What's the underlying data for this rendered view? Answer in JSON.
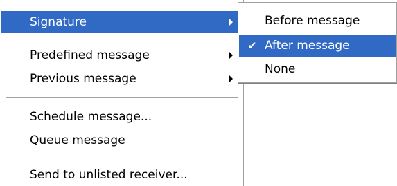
{
  "main_menu": {
    "items": [
      {
        "label": "Signature",
        "has_submenu": true,
        "highlighted": true
      },
      {
        "label": "Predefined message",
        "has_submenu": true
      },
      {
        "label": "Previous message",
        "has_submenu": true
      },
      {
        "label": "Schedule message..."
      },
      {
        "label": "Queue message"
      },
      {
        "label": "Send to unlisted receiver..."
      }
    ]
  },
  "signature_submenu": {
    "items": [
      {
        "label": "Before message"
      },
      {
        "label": "After message",
        "checked": true,
        "highlighted": true
      },
      {
        "label": "None"
      }
    ]
  },
  "colors": {
    "highlight": "#316ac5",
    "highlight_text": "#ffffff",
    "separator": "#a0a0a0"
  },
  "icons": {
    "submenu_arrow": "submenu-arrow-icon",
    "checkmark": "checkmark-icon"
  }
}
